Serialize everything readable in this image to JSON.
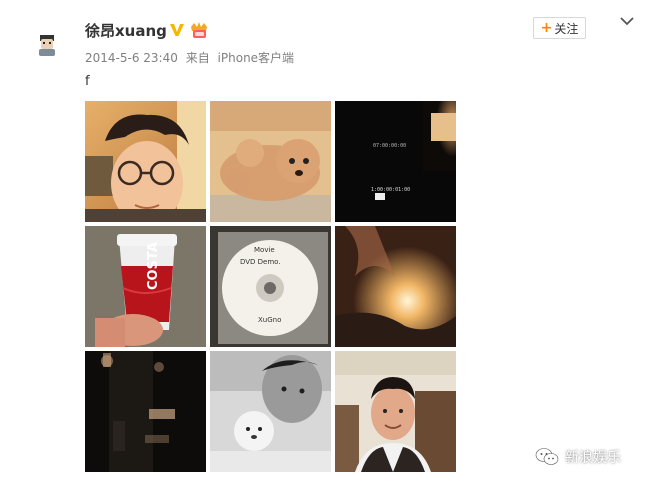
{
  "post": {
    "username": "徐昂xuang",
    "timestamp": "2014-5-6 23:40",
    "source_prefix": "来自",
    "source": "iPhone客户端",
    "text": "f",
    "follow_label": "关注",
    "follow_plus": "+"
  },
  "icons": {
    "avatar": "avatar-icon",
    "verified": "verified-v-icon",
    "vip": "vip-badge-icon",
    "menu": "chevron-down-icon",
    "watermark": "wechat-logo-icon"
  },
  "images": [
    {
      "name": "selfie-glasses-photo",
      "interactable": true
    },
    {
      "name": "poodle-dog-photo",
      "interactable": true
    },
    {
      "name": "dark-screen-photo",
      "interactable": true
    },
    {
      "name": "costa-coffee-cup-photo",
      "interactable": true
    },
    {
      "name": "dvd-disc-photo",
      "interactable": true
    },
    {
      "name": "fire-photo",
      "interactable": true
    },
    {
      "name": "dark-room-photo",
      "interactable": true
    },
    {
      "name": "selfie-with-dog-bw-photo",
      "interactable": true
    },
    {
      "name": "portrait-vest-photo",
      "interactable": true
    }
  ],
  "photo_text": {
    "costa": "COSTA",
    "dvd_line1": "Movie",
    "dvd_line2": "DVD Demo.",
    "dvd_line3": "XuGno",
    "screen_line1": "07:00:00:00",
    "screen_line2": "1:00:00:01:00"
  },
  "watermark": {
    "label": "新浪娱乐"
  },
  "colors": {
    "accent": "#ff8200",
    "name": "#333333",
    "meta": "#808080",
    "verified": "#f5b800"
  }
}
